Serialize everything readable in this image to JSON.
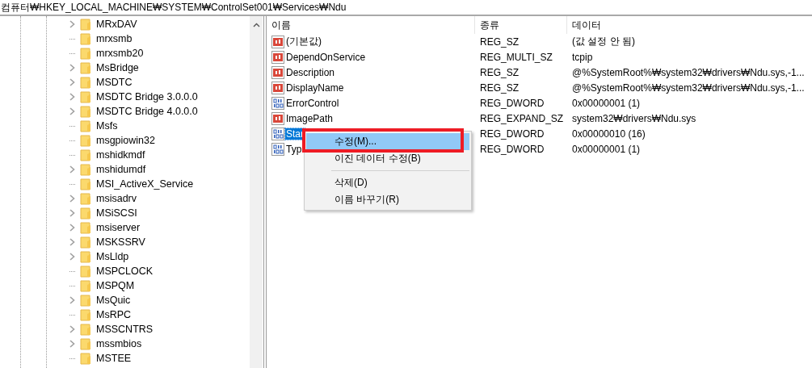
{
  "address_bar": "컴퓨터₩HKEY_LOCAL_MACHINE₩SYSTEM₩ControlSet001₩Services₩Ndu",
  "tree": {
    "items": [
      {
        "label": "MRxDAV",
        "expandable": true
      },
      {
        "label": "mrxsmb",
        "expandable": false
      },
      {
        "label": "mrxsmb20",
        "expandable": false
      },
      {
        "label": "MsBridge",
        "expandable": true
      },
      {
        "label": "MSDTC",
        "expandable": true
      },
      {
        "label": "MSDTC Bridge 3.0.0.0",
        "expandable": true
      },
      {
        "label": "MSDTC Bridge 4.0.0.0",
        "expandable": true
      },
      {
        "label": "Msfs",
        "expandable": false
      },
      {
        "label": "msgpiowin32",
        "expandable": false
      },
      {
        "label": "mshidkmdf",
        "expandable": false
      },
      {
        "label": "mshidumdf",
        "expandable": true
      },
      {
        "label": "MSI_ActiveX_Service",
        "expandable": false
      },
      {
        "label": "msisadrv",
        "expandable": true
      },
      {
        "label": "MSiSCSI",
        "expandable": true
      },
      {
        "label": "msiserver",
        "expandable": true
      },
      {
        "label": "MSKSSRV",
        "expandable": true
      },
      {
        "label": "MsLldp",
        "expandable": true
      },
      {
        "label": "MSPCLOCK",
        "expandable": false
      },
      {
        "label": "MSPQM",
        "expandable": false
      },
      {
        "label": "MsQuic",
        "expandable": true
      },
      {
        "label": "MsRPC",
        "expandable": false
      },
      {
        "label": "MSSCNTRS",
        "expandable": true
      },
      {
        "label": "mssmbios",
        "expandable": true
      },
      {
        "label": "MSTEE",
        "expandable": false
      }
    ]
  },
  "table": {
    "columns": [
      "이름",
      "종류",
      "데이터"
    ],
    "rows": [
      {
        "kind": "string",
        "name": "(기본값)",
        "type": "REG_SZ",
        "data": "(값 설정 안 됨)",
        "selected": false
      },
      {
        "kind": "string",
        "name": "DependOnService",
        "type": "REG_MULTI_SZ",
        "data": "tcpip",
        "selected": false
      },
      {
        "kind": "string",
        "name": "Description",
        "type": "REG_SZ",
        "data": "@%SystemRoot%₩system32₩drivers₩Ndu.sys,-1...",
        "selected": false
      },
      {
        "kind": "string",
        "name": "DisplayName",
        "type": "REG_SZ",
        "data": "@%SystemRoot%₩system32₩drivers₩Ndu.sys,-1...",
        "selected": false
      },
      {
        "kind": "binary",
        "name": "ErrorControl",
        "type": "REG_DWORD",
        "data": "0x00000001 (1)",
        "selected": false
      },
      {
        "kind": "string",
        "name": "ImagePath",
        "type": "REG_EXPAND_SZ",
        "data": "system32₩drivers₩Ndu.sys",
        "selected": false
      },
      {
        "kind": "binary",
        "name": "Star",
        "type": "REG_DWORD",
        "data": "0x00000010 (16)",
        "selected": true
      },
      {
        "kind": "binary",
        "name": "Typ",
        "type": "REG_DWORD",
        "data": "0x00000001 (1)",
        "selected": false
      }
    ]
  },
  "context_menu": {
    "items": [
      {
        "kind": "item",
        "label": "수정(M)...",
        "selected": true
      },
      {
        "kind": "item",
        "label": "이진 데이터 수정(B)",
        "selected": false
      },
      {
        "kind": "separator"
      },
      {
        "kind": "item",
        "label": "삭제(D)",
        "selected": false
      },
      {
        "kind": "item",
        "label": "이름 바꾸기(R)",
        "selected": false
      }
    ]
  }
}
